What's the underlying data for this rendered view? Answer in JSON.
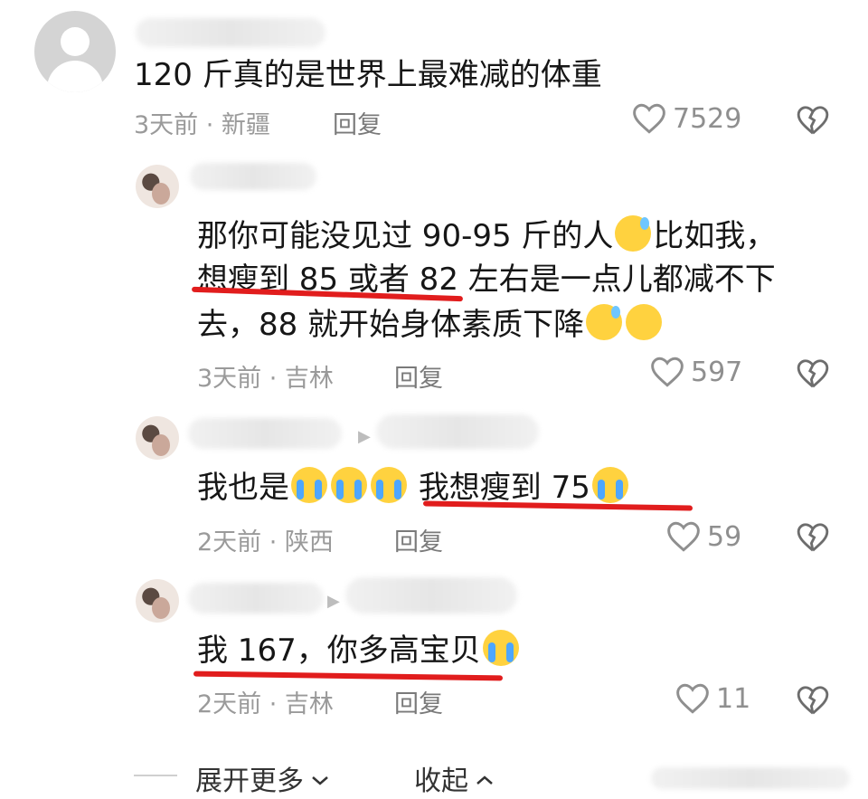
{
  "comments": [
    {
      "text": "120 斤真的是世界上最难减的体重",
      "meta": "3天前 · 新疆",
      "reply_label": "回复",
      "likes": "7529"
    },
    {
      "text_line1": "那你可能没见过 90-95 斤的人",
      "text_line1_after": "比如我，",
      "text_line2": "想瘦到 85 或者 82 左右是一点儿都减不下",
      "text_line3": "去，88 就开始身体素质下降",
      "meta": "3天前 · 吉林",
      "reply_label": "回复",
      "likes": "597"
    },
    {
      "text_start": "我也是",
      "text_end": "我想瘦到 75",
      "meta": "2天前 · 陕西",
      "reply_label": "回复",
      "likes": "59"
    },
    {
      "text": "我 167，你多高宝贝",
      "meta": "2天前 · 吉林",
      "reply_label": "回复",
      "likes": "11"
    }
  ],
  "footer": {
    "expand_label": "展开更多",
    "collapse_label": "收起"
  },
  "colors": {
    "annotation_red": "#e11d1d",
    "meta_gray": "#9a9a9a"
  }
}
